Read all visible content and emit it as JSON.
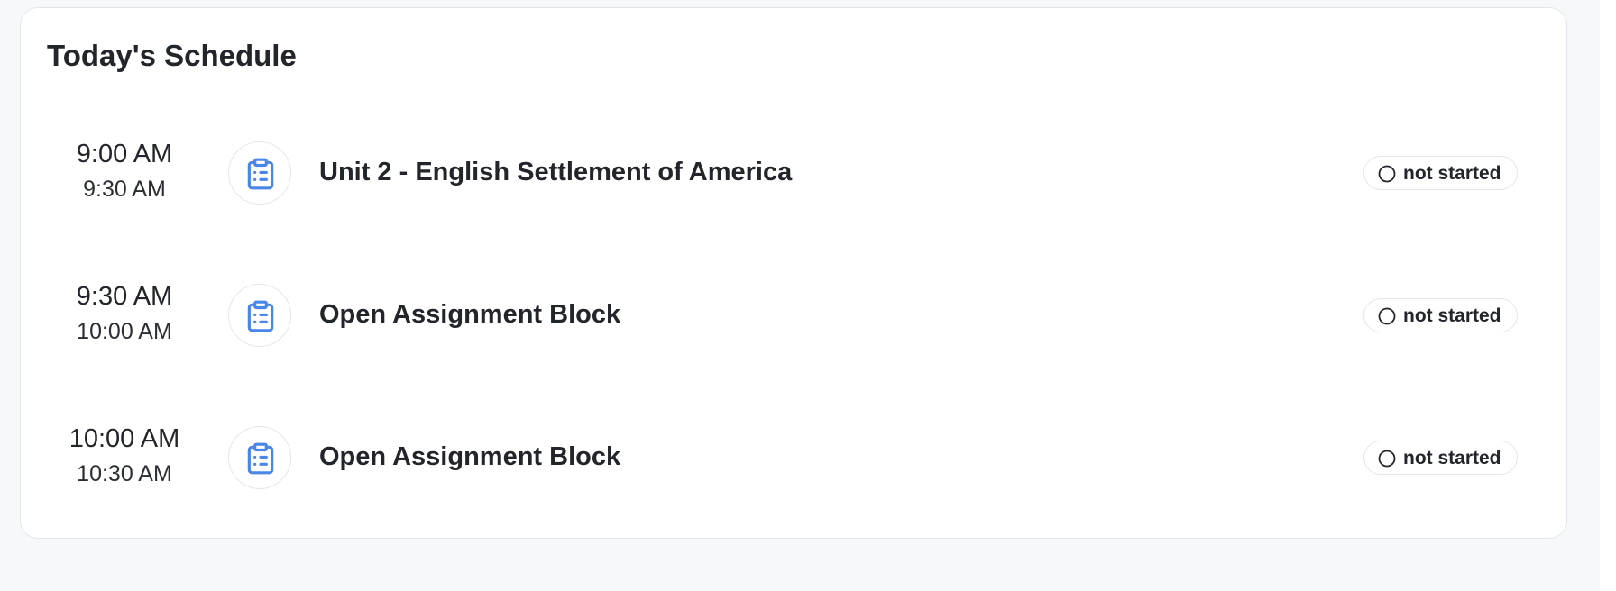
{
  "schedule": {
    "title": "Today's Schedule",
    "accent_color": "#4a86e8",
    "items": [
      {
        "start": "9:00 AM",
        "end": "9:30 AM",
        "icon": "clipboard-list-icon",
        "title": "Unit 2 - English Settlement of America",
        "status": "not started",
        "status_icon": "circle-outline-icon"
      },
      {
        "start": "9:30 AM",
        "end": "10:00 AM",
        "icon": "clipboard-list-icon",
        "title": "Open Assignment Block",
        "status": "not started",
        "status_icon": "circle-outline-icon"
      },
      {
        "start": "10:00 AM",
        "end": "10:30 AM",
        "icon": "clipboard-list-icon",
        "title": "Open Assignment Block",
        "status": "not started",
        "status_icon": "circle-outline-icon"
      }
    ]
  }
}
